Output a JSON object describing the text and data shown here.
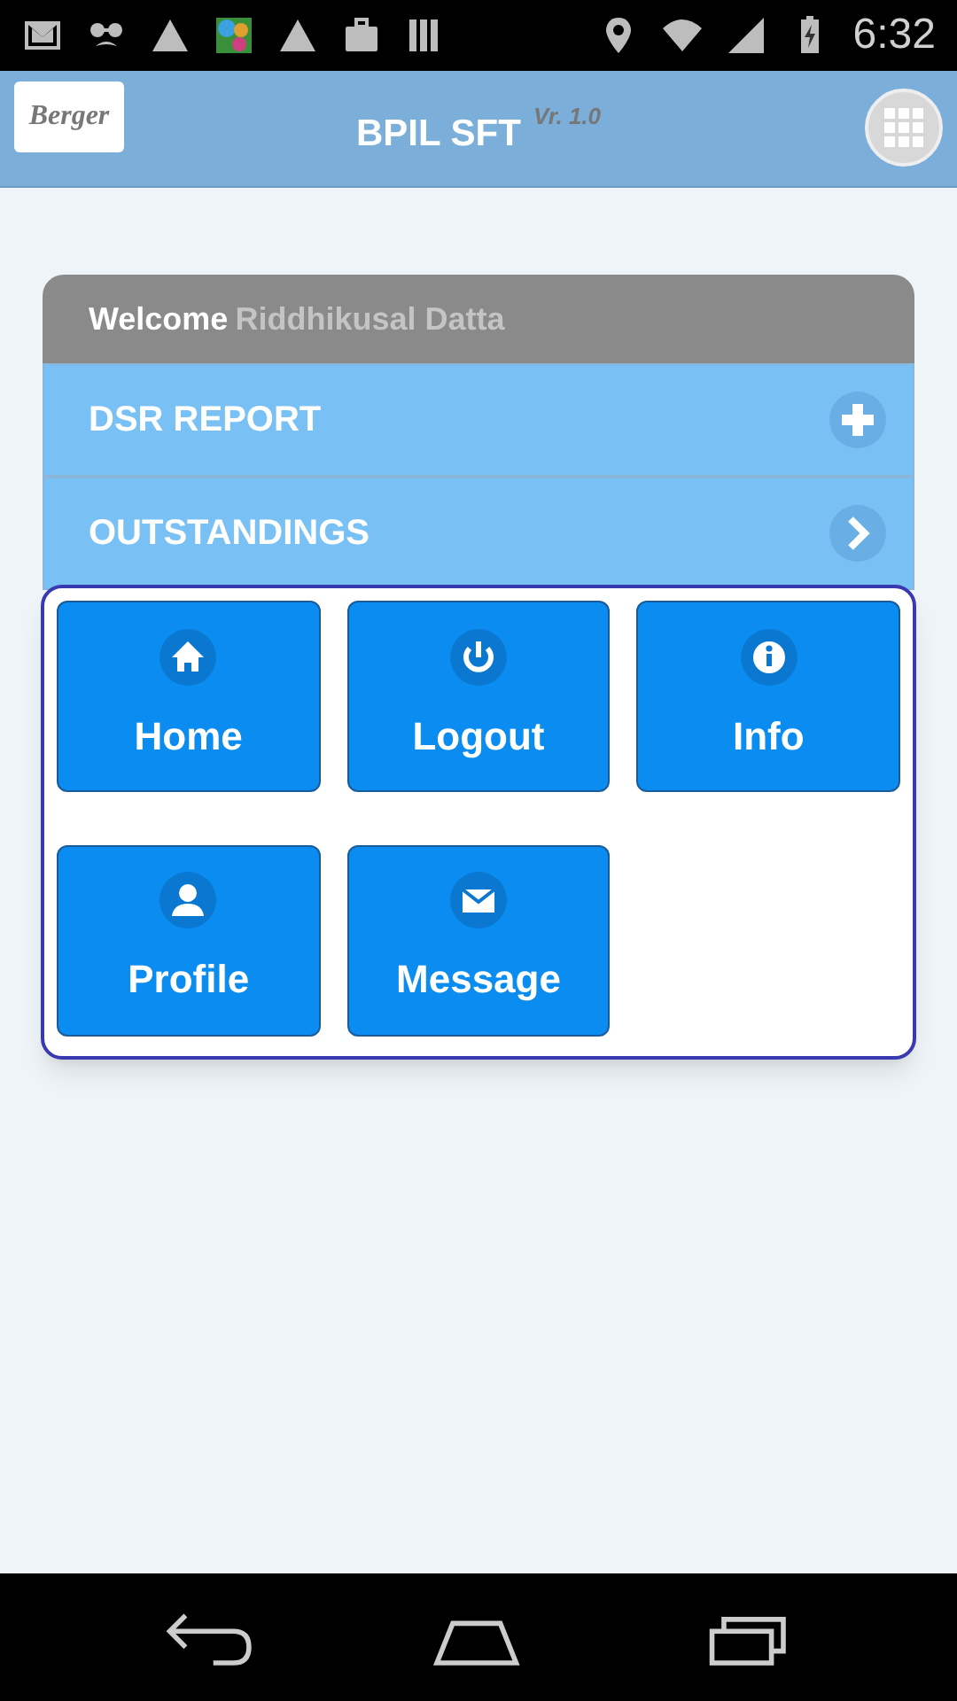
{
  "status_bar": {
    "time": "6:32"
  },
  "header": {
    "logo": "Berger",
    "title": "BPIL SFT",
    "version": "Vr. 1.0"
  },
  "welcome": {
    "label": "Welcome",
    "user": "Riddhikusal Datta"
  },
  "accordion": [
    {
      "label": "DSR REPORT",
      "kind": "plus"
    },
    {
      "label": "OUTSTANDINGS",
      "kind": "chevron"
    }
  ],
  "menu": [
    {
      "label": "Home",
      "kind": "home"
    },
    {
      "label": "Logout",
      "kind": "power"
    },
    {
      "label": "Info",
      "kind": "info"
    },
    {
      "label": "Profile",
      "kind": "user"
    },
    {
      "label": "Message",
      "kind": "mail"
    }
  ]
}
